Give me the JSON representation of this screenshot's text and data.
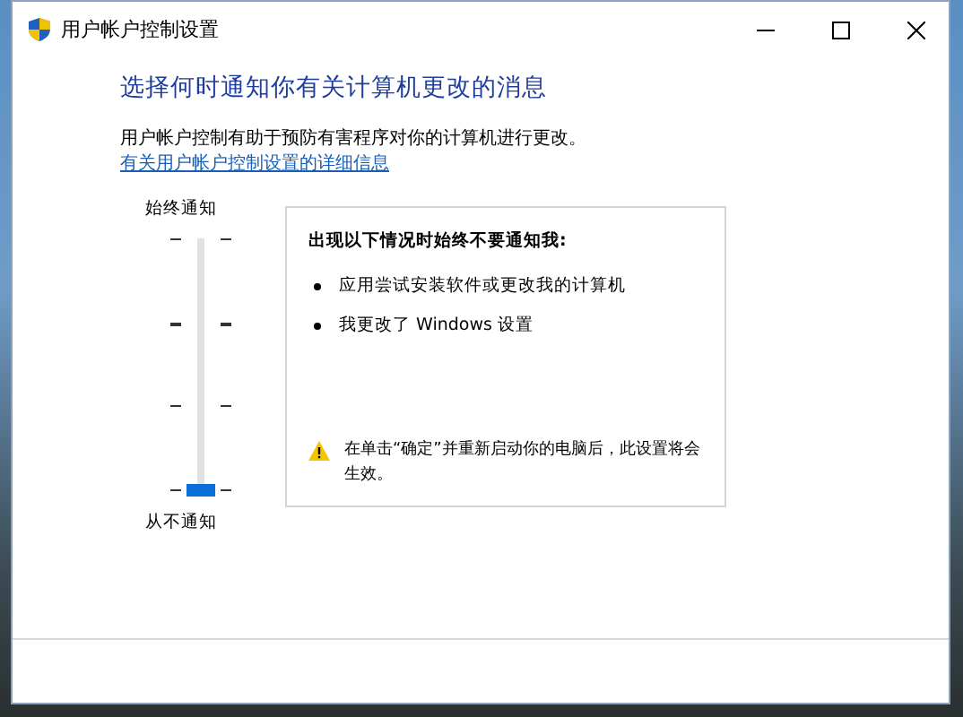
{
  "window": {
    "title": "用户帐户控制设置"
  },
  "heading": "选择何时通知你有关计算机更改的消息",
  "description": "用户帐户控制有助于预防有害程序对你的计算机进行更改。",
  "link": "有关用户帐户控制设置的详细信息",
  "slider": {
    "top_label": "始终通知",
    "bottom_label": "从不通知",
    "level": 0
  },
  "info": {
    "title": "出现以下情况时始终不要通知我:",
    "bullets": [
      "应用尝试安装软件或更改我的计算机",
      "我更改了 Windows 设置"
    ],
    "warning": "在单击“确定”并重新启动你的电脑后，此设置将会生效。"
  }
}
